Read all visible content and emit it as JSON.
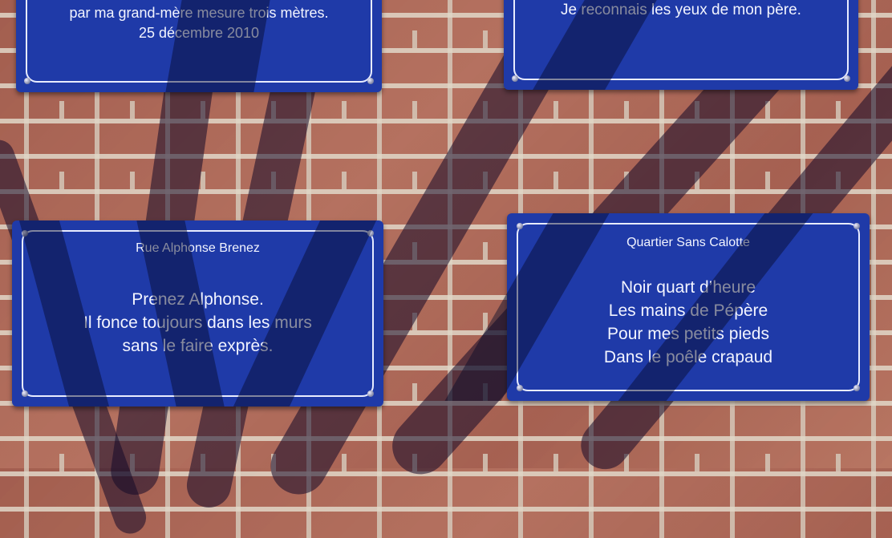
{
  "plaques": {
    "top_left": {
      "lines": [
        "par ma grand-mère mesure trois mètres.",
        "25 décembre 2010"
      ]
    },
    "top_right": {
      "lines": [
        "Je reconnais les yeux de mon père."
      ]
    },
    "bottom_left": {
      "title": "Rue Alphonse Brenez",
      "lines": [
        "Prenez Alphonse.",
        "Il fonce toujours dans les murs",
        "sans le faire exprès."
      ]
    },
    "bottom_right": {
      "title": "Quartier Sans Calotte",
      "lines": [
        "Noir quart d’heure",
        "Les mains de Pépère",
        "Pour mes petits pieds",
        "Dans le poêle crapaud"
      ]
    }
  },
  "colors": {
    "plaque_blue": "#1f3aa8",
    "brick": "#b1705f",
    "mortar": "#e1d7c8"
  }
}
